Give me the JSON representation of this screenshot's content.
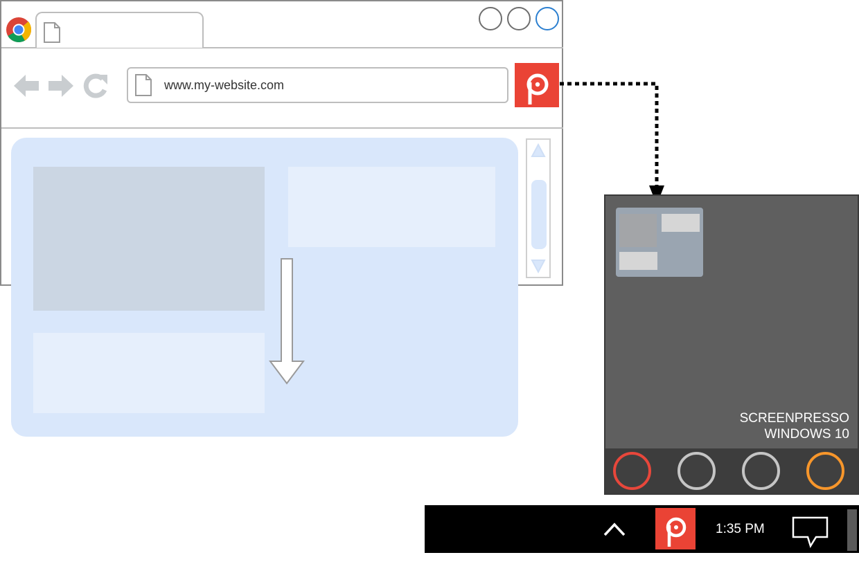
{
  "browser": {
    "address_url": "www.my-website.com",
    "window_buttons": [
      "minimize",
      "maximize",
      "close"
    ],
    "icons": {
      "logo": "chrome-logo-icon",
      "back": "arrow-left-icon",
      "forward": "arrow-right-icon",
      "reload": "reload-icon",
      "tab_page": "document-icon",
      "extension": "screenpresso-icon"
    }
  },
  "screenpresso_window": {
    "caption_line1": "SCREENPRESSO",
    "caption_line2": "WINDOWS 10",
    "ring_colors": [
      "#e8473b",
      "#c5c5c5",
      "#c5c5c5",
      "#f7962b"
    ]
  },
  "taskbar": {
    "time": "1:35 PM",
    "icons": [
      "chevron-up-icon",
      "screenpresso-icon",
      "notification-icon"
    ]
  },
  "colors": {
    "brand_red": "#ea4335",
    "page_blue": "#d9e7fb",
    "window_gray": "#5f5f5f"
  }
}
